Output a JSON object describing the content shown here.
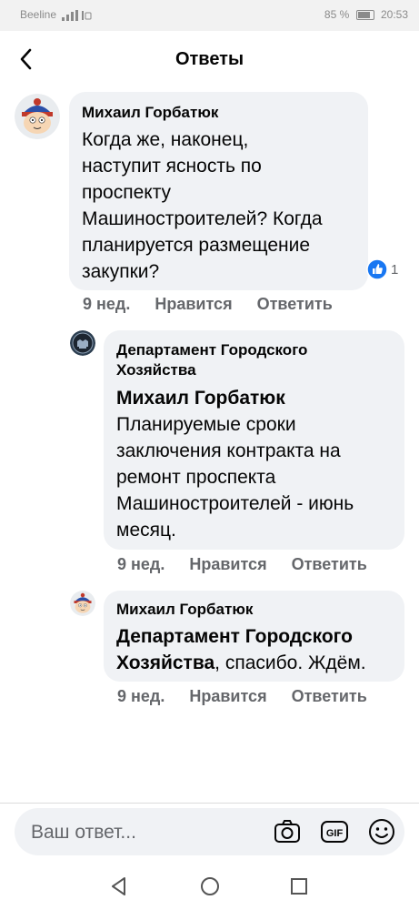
{
  "status_bar": {
    "carrier": "Beeline",
    "battery": "85 %",
    "time": "20:53"
  },
  "header": {
    "title": "Ответы"
  },
  "comments": [
    {
      "author": "Михаил Горбатюк",
      "lines": [
        "Когда же, наконец,",
        "наступит ясность по",
        "проспекту",
        "Машиностроителей? Когда",
        "планируется размещение",
        "закупки?"
      ],
      "reaction_count": "1",
      "time": "9 нед.",
      "like": "Нравится",
      "reply": "Ответить"
    },
    {
      "author_line1": "Департамент Городского",
      "author_line2": "Хозяйства",
      "mention": "Михаил Горбатюк",
      "lines": [
        "Планируемые сроки",
        "заключения контракта на",
        "ремонт проспекта",
        "Машиностроителей - июнь",
        "месяц."
      ],
      "time": "9 нед.",
      "like": "Нравится",
      "reply": "Ответить"
    },
    {
      "author": "Михаил Горбатюк",
      "mention_line1": "Департамент Городского",
      "mention_line2": "Хозяйства",
      "rest": ", спасибо. Ждём.",
      "time": "9 нед.",
      "like": "Нравится",
      "reply": "Ответить"
    }
  ],
  "composer": {
    "placeholder": "Ваш ответ...",
    "icons": [
      "camera-icon",
      "gif-icon",
      "emoji-icon"
    ]
  },
  "colors": {
    "bubble": "#f0f2f5",
    "like_blue": "#1877f2",
    "muted": "#65676b"
  }
}
